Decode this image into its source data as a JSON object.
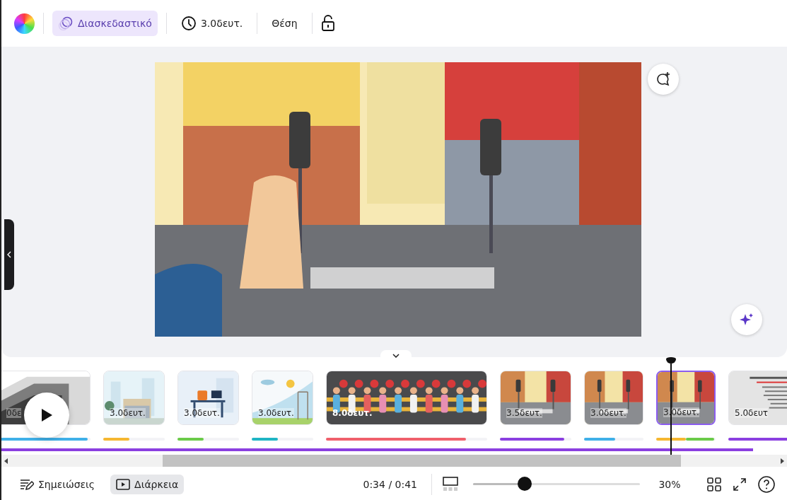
{
  "toolbar": {
    "animation_button": {
      "label": "Διασκεδαστικό",
      "selected": true
    },
    "duration_button": "3.0δευτ.",
    "position_button": "Θέση"
  },
  "timeline": {
    "pages": [
      {
        "kind": "intro",
        "label": "0δε",
        "selected": false,
        "tracks": [
          {
            "color": "#3fb0e8",
            "level": 0.97
          }
        ]
      },
      {
        "kind": "city",
        "label": "3.0δευτ.",
        "selected": false,
        "tracks": [
          {
            "color": "#f5b731",
            "level": 0.42
          }
        ]
      },
      {
        "kind": "office",
        "label": "3.0δευτ.",
        "selected": false,
        "tracks": [
          {
            "color": "#6bcb4a",
            "level": 0.43
          }
        ]
      },
      {
        "kind": "park",
        "label": "3.0δευτ.",
        "selected": false,
        "tracks": [
          {
            "color": "#1fb5c4",
            "level": 0.42
          }
        ]
      },
      {
        "kind": "crowd",
        "label": "8.0δευτ.",
        "selected": false,
        "tracks": [
          {
            "color": "#f0606c",
            "level": 0.87
          }
        ]
      },
      {
        "kind": "street_long",
        "label": "3.5δευτ.",
        "selected": false,
        "tracks": [
          {
            "color": "#8b3fe0",
            "level": 0.9
          }
        ]
      },
      {
        "kind": "street",
        "label": "3.0δευτ.",
        "selected": false,
        "tracks": [
          {
            "color": "#3fb0e8",
            "level": 0.52
          }
        ]
      },
      {
        "kind": "street",
        "label": "3.0δευτ.",
        "selected": true,
        "tracks": [
          {
            "color": "#f5b731",
            "level": 0.5
          },
          {
            "color": "#6bcb4a",
            "level": 0.48
          }
        ]
      },
      {
        "kind": "document",
        "label": "5.0δευτ",
        "selected": false,
        "tracks": [
          {
            "color": "#8b3fe0",
            "level": 1
          }
        ]
      }
    ]
  },
  "footer": {
    "notes_button": "Σημειώσεις",
    "duration_button": {
      "label": "Διάρκεια",
      "selected": true
    },
    "time": "0:34 / 0:41",
    "zoom": {
      "level": 0.31,
      "reading": "30%"
    }
  }
}
